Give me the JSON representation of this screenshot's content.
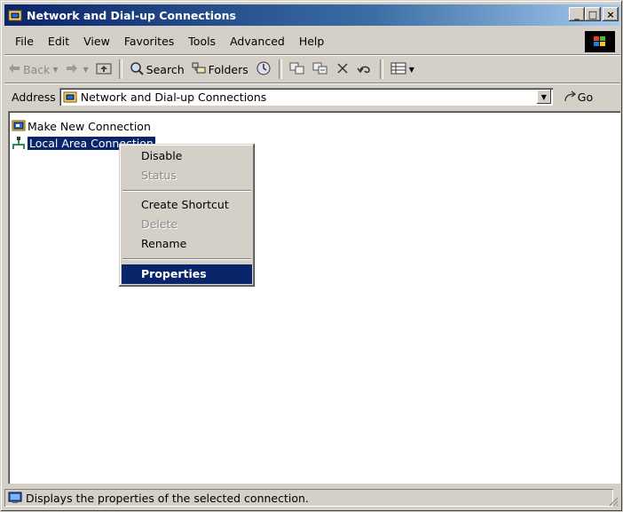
{
  "window": {
    "title": "Network and Dial-up Connections"
  },
  "title_buttons": {
    "minimize": "_",
    "maximize": "□",
    "close": "×"
  },
  "menubar": {
    "items": [
      "File",
      "Edit",
      "View",
      "Favorites",
      "Tools",
      "Advanced",
      "Help"
    ]
  },
  "toolbar": {
    "back": "Back",
    "search": "Search",
    "folders": "Folders"
  },
  "address": {
    "label": "Address",
    "value": "Network and Dial-up Connections",
    "go": "Go"
  },
  "content": {
    "items": [
      {
        "label": "Make New Connection",
        "icon": "new-connection-icon",
        "selected": false
      },
      {
        "label": "Local Area Connection",
        "icon": "lan-connection-icon",
        "selected": true
      }
    ]
  },
  "context_menu": {
    "items": [
      {
        "label": "Disable",
        "disabled": false
      },
      {
        "label": "Status",
        "disabled": true
      },
      {
        "label": "Create Shortcut",
        "disabled": false
      },
      {
        "label": "Delete",
        "disabled": true
      },
      {
        "label": "Rename",
        "disabled": false
      },
      {
        "label": "Properties",
        "disabled": false,
        "highlighted": true
      }
    ]
  },
  "statusbar": {
    "text": "Displays the properties of the selected connection."
  },
  "colors": {
    "title_start": "#0a246a",
    "title_end": "#a6caf0",
    "selection": "#0a246a",
    "face": "#d4d0c8"
  }
}
